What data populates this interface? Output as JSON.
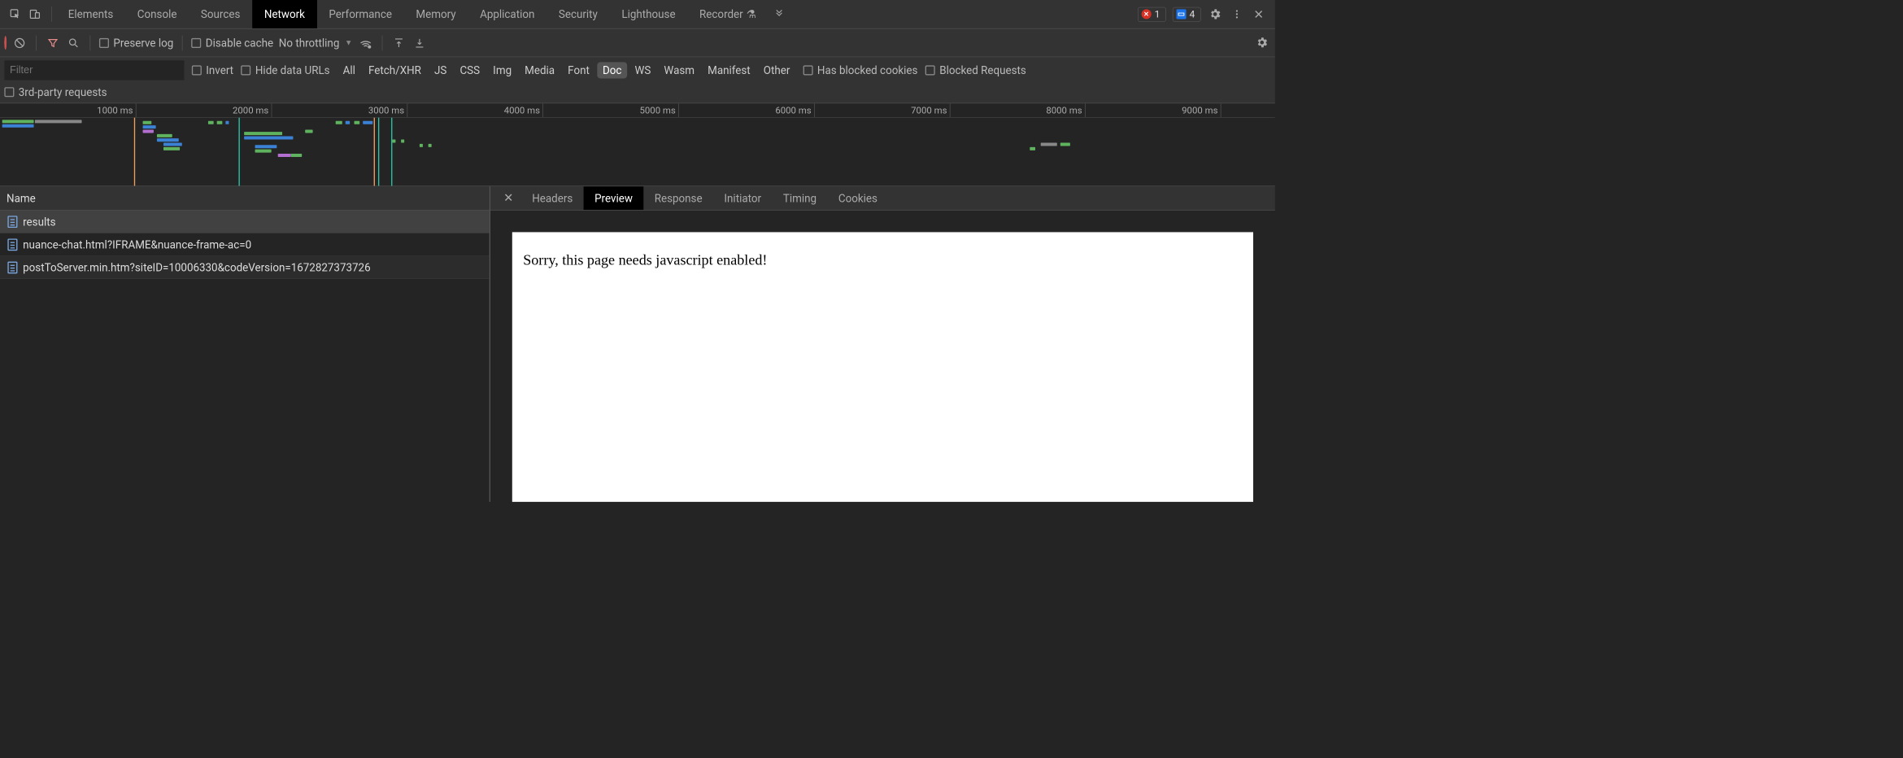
{
  "tabs": {
    "items": [
      "Elements",
      "Console",
      "Sources",
      "Network",
      "Performance",
      "Memory",
      "Application",
      "Security",
      "Lighthouse",
      "Recorder"
    ],
    "active": "Network"
  },
  "badges": {
    "errors": "1",
    "messages": "4"
  },
  "toolbar": {
    "preserve_log": "Preserve log",
    "disable_cache": "Disable cache",
    "throttling": "No throttling"
  },
  "filter": {
    "placeholder": "Filter",
    "invert": "Invert",
    "hide_data_urls": "Hide data URLs",
    "types": [
      "All",
      "Fetch/XHR",
      "JS",
      "CSS",
      "Img",
      "Media",
      "Font",
      "Doc",
      "WS",
      "Wasm",
      "Manifest",
      "Other"
    ],
    "active_type": "Doc",
    "has_blocked_cookies": "Has blocked cookies",
    "blocked_requests": "Blocked Requests",
    "third_party": "3rd-party requests"
  },
  "timeline": {
    "ticks": [
      "1000 ms",
      "2000 ms",
      "3000 ms",
      "4000 ms",
      "5000 ms",
      "6000 ms",
      "7000 ms",
      "8000 ms",
      "9000 ms"
    ]
  },
  "requests": {
    "header": "Name",
    "rows": [
      "results",
      "nuance-chat.html?IFRAME&nuance-frame-ac=0",
      "postToServer.min.htm?siteID=10006330&codeVersion=1672827373726"
    ]
  },
  "detail_tabs": {
    "items": [
      "Headers",
      "Preview",
      "Response",
      "Initiator",
      "Timing",
      "Cookies"
    ],
    "active": "Preview"
  },
  "preview_body": "Sorry, this page needs javascript enabled!"
}
